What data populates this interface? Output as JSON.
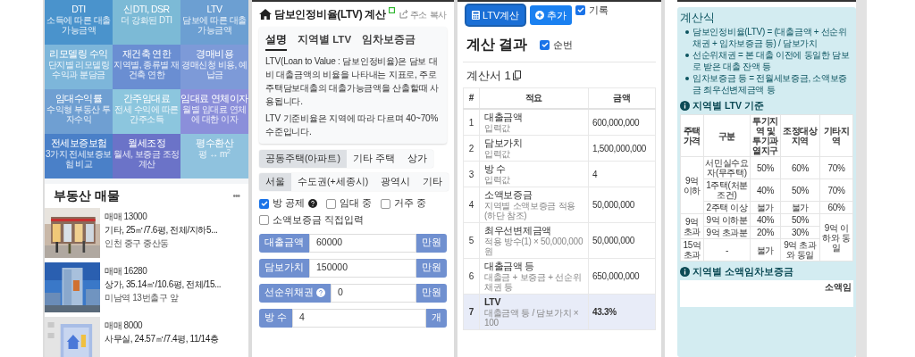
{
  "tiles": [
    {
      "title": "DTI",
      "subtitle": "소득에 따른 대출 가능금액",
      "color": "#4a93cc"
    },
    {
      "title": "신DTI, DSR",
      "subtitle": "더 강화된 DTI",
      "color": "#7cbad6"
    },
    {
      "title": "LTV",
      "subtitle": "담보에 따른 대출 가능금액",
      "color": "#6c9fd2"
    },
    {
      "title": "리모델링 수익",
      "subtitle": "단지별 리모델링 수익과 분담금",
      "color": "#7db6da"
    },
    {
      "title": "재건축 연한",
      "subtitle": "지역별, 종류별 재건축 연한",
      "color": "#6a8ed2"
    },
    {
      "title": "경매비용",
      "subtitle": "경매신청 비용, 예납금",
      "color": "#7d9ad8"
    },
    {
      "title": "임대수익률",
      "subtitle": "수익형 부동산 투자수익",
      "color": "#6f9fd2"
    },
    {
      "title": "간주임대료",
      "subtitle": "전세 수익에 따른 간주소득",
      "color": "#8cc6de"
    },
    {
      "title": "임대료 연체이자",
      "subtitle": "월별 임대료 연체에 대한 이자",
      "color": "#8b8fda"
    },
    {
      "title": "전세보증보험",
      "subtitle": "3가지 전세보증보험 비교",
      "color": "#4a80c8"
    },
    {
      "title": "월세조정",
      "subtitle": "월세, 보증금 조정 계산",
      "color": "#6b73c8"
    },
    {
      "title": "평수환산",
      "subtitle": "평 ↔ m$^{2}$",
      "color": "#8fc2de"
    }
  ],
  "listings": {
    "title": "부동산 매물",
    "more": "•••",
    "items": [
      {
        "price": "매매 13000",
        "detail": "기타, 25㎡/7.6평, 전체/지하5...",
        "location": "인천 중구 중산동"
      },
      {
        "price": "매매 16280",
        "detail": "상가, 35.14㎡/10.6평, 전체/15...",
        "location": "미남역 13번출구 앞"
      },
      {
        "price": "매매 8000",
        "detail": "사무실, 24.57㎡/7.4평, 11/14층"
      }
    ]
  },
  "calculator": {
    "title": "담보인정비율(LTV) 계산",
    "share": "주소 복사",
    "tabs": [
      {
        "label": "설명",
        "selected": true
      },
      {
        "label": "지역별 LTV",
        "selected": false
      },
      {
        "label": "임차보증금",
        "selected": false
      }
    ],
    "paragraphs": [
      "LTV(Loan to Value : 담보인정비율)은 담보 대비 대출금액의 비율을 나타내는 지표로, 주로 주택담보대출의 대출가능금액을 산출할때 사용됩니다.",
      "LTV 기준비율은 지역에 따라 다르며 40~70% 수준입니다."
    ],
    "house_types": [
      {
        "label": "공동주택(아파트)",
        "selected": true
      },
      {
        "label": "기타 주택",
        "selected": false
      },
      {
        "label": "상가",
        "selected": false
      }
    ],
    "regions": [
      {
        "label": "서울",
        "selected": true
      },
      {
        "label": "수도권(+세종시)",
        "selected": false
      },
      {
        "label": "광역시",
        "selected": false
      },
      {
        "label": "기타",
        "selected": false
      }
    ],
    "checkbox_rows": [
      [
        {
          "label": "방 공제",
          "checked": true,
          "help": true
        },
        {
          "label": "임대 중",
          "checked": false
        },
        {
          "label": "거주 중",
          "checked": false
        }
      ],
      [
        {
          "label": "소액보증금 직접입력",
          "checked": false
        }
      ]
    ],
    "inputs": [
      {
        "label": "대출금액",
        "value": "60000",
        "unit": "만원"
      },
      {
        "label": "담보가치",
        "value": "150000",
        "unit": "만원"
      },
      {
        "label": "선순위채권",
        "value": "0",
        "unit": "만원",
        "help": true
      },
      {
        "label": "방 수",
        "value": "4",
        "unit": "개"
      }
    ]
  },
  "result": {
    "buttons": [
      {
        "label": "LTV계산",
        "kind": "calc"
      },
      {
        "label": "추가",
        "kind": "add"
      }
    ],
    "record": {
      "label": "기록",
      "checked": true
    },
    "title": "계산 결과",
    "numbering": {
      "label": "순번",
      "checked": true
    },
    "sheet": "계산서 1",
    "columns": [
      "#",
      "적요",
      "금액"
    ],
    "rows": [
      {
        "no": "1",
        "label": "대출금액",
        "note": "입력값",
        "amount": "600,000,000",
        "highlighted": false
      },
      {
        "no": "2",
        "label": "담보가치",
        "note": "입력값",
        "amount": "1,500,000,000",
        "highlighted": false
      },
      {
        "no": "3",
        "label": "방 수",
        "note": "입력값",
        "amount": "4",
        "highlighted": false
      },
      {
        "no": "4",
        "label": "소액보증금",
        "note": "지역별 소액보증금 적용(하단 참조)",
        "amount": "50,000,000",
        "highlighted": false
      },
      {
        "no": "5",
        "label": "최우선변제금액",
        "note": "적용 방수(1) × 50,000,000원",
        "amount": "50,000,000",
        "highlighted": false
      },
      {
        "no": "6",
        "label": "대출금액 등",
        "note": "대출금 + 보증금 + 선순위채권 등",
        "amount": "650,000,000",
        "highlighted": false
      },
      {
        "no": "7",
        "label": "LTV",
        "note": "대출금액 등 / 담보가치 × 100",
        "amount": "43.3%",
        "highlighted": true
      }
    ]
  },
  "formula": {
    "title": "계산식",
    "bullets": [
      "담보인정비율(LTV) = (대출금액 + 선순위채권 + 임차보증금 등) / 담보가치",
      "선순위채권 = 본 대출 이전에 동일한 담보로 받은 대출 잔액 등",
      "임차보증금 등 = 전월세보증금, 소액보증금 최우선변제금액 등"
    ],
    "ltv_title": "지역별 LTV 기준",
    "ltv_columns": [
      "주택가격",
      "구분",
      "투기지역 및 투기과열지구",
      "조정대상지역",
      "기타지역"
    ],
    "ltv_groups": [
      {
        "price": "9억 이하",
        "items": [
          {
            "label": "서민실수요자(무주택)",
            "values": [
              "50%",
              "60%",
              "70%"
            ]
          },
          {
            "label": "1주택(처분조건)",
            "values": [
              "40%",
              "50%",
              "70%"
            ]
          },
          {
            "label": "2주택 이상",
            "values": [
              "불가",
              "불가",
              "60%"
            ]
          }
        ]
      },
      {
        "price": "9억 초과",
        "items": [
          {
            "label": "9억 이하분",
            "values": [
              "40%",
              "50%"
            ]
          },
          {
            "label": "9억 초과분",
            "values": [
              "20%",
              "30%"
            ]
          }
        ]
      },
      {
        "price": "15억 초과",
        "items": [
          {
            "label": "-",
            "values": [
              "불가",
              "9억 초과와 동일"
            ]
          }
        ]
      }
    ],
    "ltv_merged": "9억 이하와 동일",
    "deposit_title": "지역별 소액임차보증금",
    "deposit_column": "소액임"
  }
}
